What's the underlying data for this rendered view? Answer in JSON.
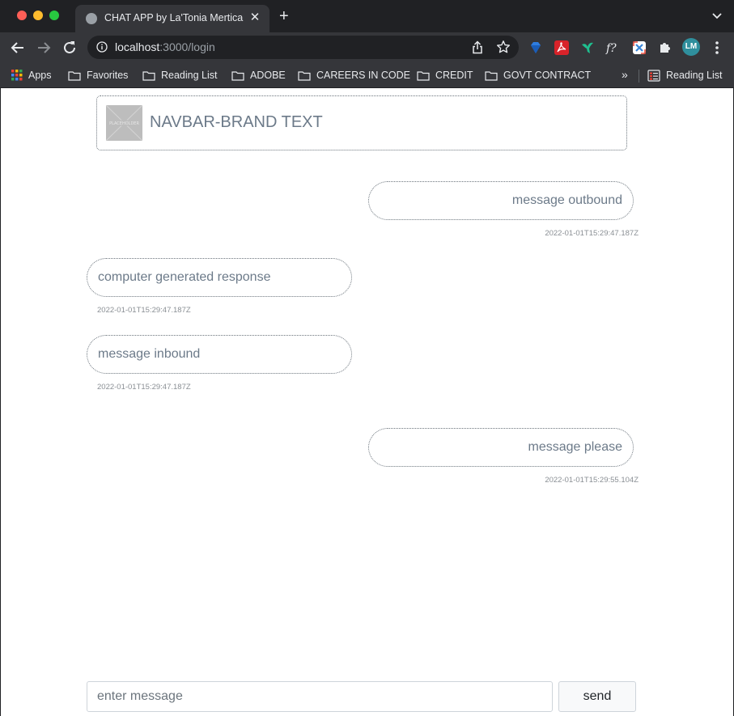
{
  "browser": {
    "tab": {
      "title": "CHAT APP by La'Tonia Mertica",
      "close_glyph": "✕"
    },
    "new_tab_glyph": "+",
    "omnibox": {
      "host": "localhost",
      "path": ":3000/login"
    },
    "profile_initials": "LM",
    "icons": [
      "back-icon",
      "forward-icon",
      "reload-icon",
      "info-icon",
      "share-icon",
      "star-icon",
      "extensions-puzzle-icon",
      "more-icon"
    ]
  },
  "bookmarks": {
    "apps_label": "Apps",
    "items": [
      "Favorites",
      "Reading List",
      "ADOBE",
      "CAREERS IN CODE",
      "CREDIT",
      "GOVT CONTRACT"
    ],
    "overflow_glyph": "»",
    "reading_list_label": "Reading List"
  },
  "app": {
    "brand_text": "NAVBAR-BRAND TEXT",
    "brand_image_text": "PLACEHOLDER",
    "messages": [
      {
        "direction": "outbound",
        "text": "message outbound",
        "timestamp": "2022-01-01T15:29:47.187Z"
      },
      {
        "direction": "inbound",
        "text": "computer generated response",
        "timestamp": "2022-01-01T15:29:47.187Z"
      },
      {
        "direction": "inbound",
        "text": "message inbound",
        "timestamp": "2022-01-01T15:29:47.187Z"
      },
      {
        "direction": "outbound",
        "text": "message please",
        "timestamp": "2022-01-01T15:29:55.104Z"
      }
    ],
    "composer": {
      "placeholder": "enter message",
      "value": "",
      "send_label": "send"
    }
  },
  "colors": {
    "chrome_dark": "#202124",
    "chrome_toolbar": "#35363a",
    "bubble_text": "#6c7a89",
    "timestamp_text": "#8a8f94"
  }
}
